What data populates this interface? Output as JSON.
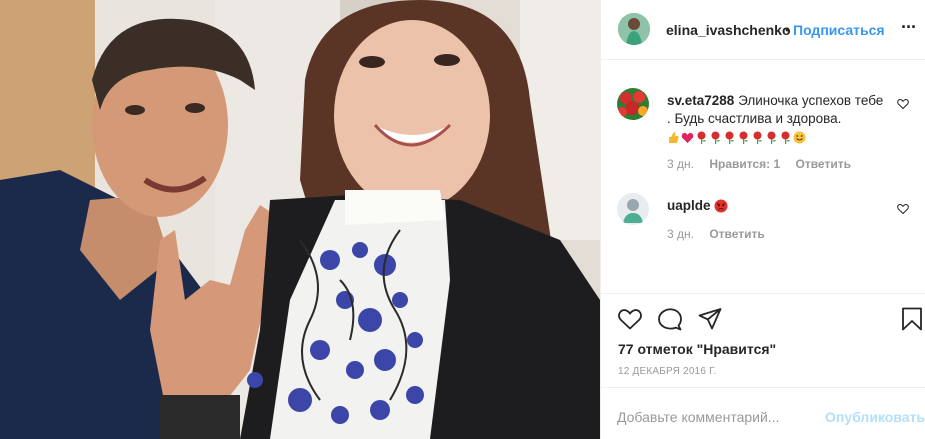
{
  "photo": {
    "alt_icon": "selfie-photo"
  },
  "header": {
    "username": "elina_ivashchenko",
    "separator": "•",
    "follow_label": "Подписаться",
    "more_label": "···"
  },
  "comments": [
    {
      "username": "sv.eta7288",
      "text": "Элиночка успехов тебе . Будь счастлива и здорова.",
      "emojis": [
        "thumbs-up",
        "red-heart",
        "rose",
        "rose",
        "rose",
        "rose",
        "rose",
        "rose",
        "rose",
        "smiling-face"
      ],
      "time": "3 дн.",
      "likes": "Нравится: 1",
      "reply": "Ответить"
    },
    {
      "username": "uaplde",
      "text": "",
      "emojis": [
        "angry-face"
      ],
      "time": "3 дн.",
      "reply": "Ответить"
    }
  ],
  "likes_text": "77 отметок \"Нравится\"",
  "date": "12 ДЕКАБРЯ 2016 Г.",
  "add_comment": {
    "placeholder": "Добавьте комментарий...",
    "publish_label": "Опубликовать"
  },
  "colors": {
    "link_blue": "#3897f0",
    "publish_disabled": "#b2dffc",
    "muted": "#999999",
    "text": "#262626"
  }
}
